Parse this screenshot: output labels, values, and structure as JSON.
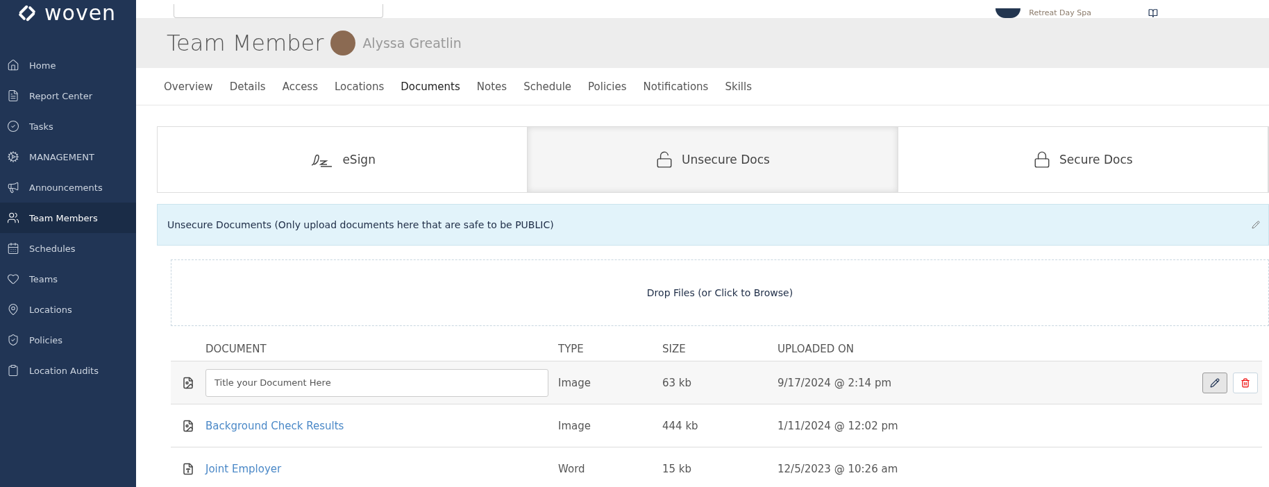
{
  "brand": {
    "name": "woven"
  },
  "sidebar": {
    "items": [
      {
        "label": "Home",
        "selected": false
      },
      {
        "label": "Report Center",
        "selected": false
      },
      {
        "label": "Tasks",
        "selected": false
      },
      {
        "label": "MANAGEMENT",
        "selected": false
      },
      {
        "label": "Announcements",
        "selected": false
      },
      {
        "label": "Team Members",
        "selected": true
      },
      {
        "label": "Schedules",
        "selected": false
      },
      {
        "label": "Teams",
        "selected": false
      },
      {
        "label": "Locations",
        "selected": false
      },
      {
        "label": "Policies",
        "selected": false
      },
      {
        "label": "Location Audits",
        "selected": false
      }
    ]
  },
  "top_bar": {
    "location": "Retreat Day Spa"
  },
  "header": {
    "title": "Team Member",
    "member": "Alyssa Greatlin"
  },
  "tabs": [
    {
      "label": "Overview",
      "selected": false
    },
    {
      "label": "Details",
      "selected": false
    },
    {
      "label": "Access",
      "selected": false
    },
    {
      "label": "Locations",
      "selected": false
    },
    {
      "label": "Documents",
      "selected": true
    },
    {
      "label": "Notes",
      "selected": false
    },
    {
      "label": "Schedule",
      "selected": false
    },
    {
      "label": "Policies",
      "selected": false
    },
    {
      "label": "Notifications",
      "selected": false
    },
    {
      "label": "Skills",
      "selected": false
    }
  ],
  "doc_types": [
    {
      "label": "eSign",
      "selected": false
    },
    {
      "label": "Unsecure Docs",
      "selected": true
    },
    {
      "label": "Secure Docs",
      "selected": false
    }
  ],
  "panel": {
    "title": "Unsecure Documents (Only upload documents here that are safe to be PUBLIC)",
    "dropzone": "Drop Files (or Click to Browse)"
  },
  "table": {
    "columns": [
      "DOCUMENT",
      "TYPE",
      "SIZE",
      "UPLOADED ON"
    ],
    "rows": [
      {
        "kind": "editing",
        "placeholder": "Title your Document Here",
        "type": "Image",
        "size": "63 kb",
        "uploaded": "9/17/2024 @ 2:14 pm"
      },
      {
        "kind": "link",
        "name": "Background Check Results",
        "type": "Image",
        "size": "444 kb",
        "uploaded": "1/11/2024 @ 12:02 pm"
      },
      {
        "kind": "link",
        "name": "Joint Employer",
        "type": "Word",
        "size": "15 kb",
        "uploaded": "12/5/2023 @ 10:26 am"
      }
    ]
  }
}
